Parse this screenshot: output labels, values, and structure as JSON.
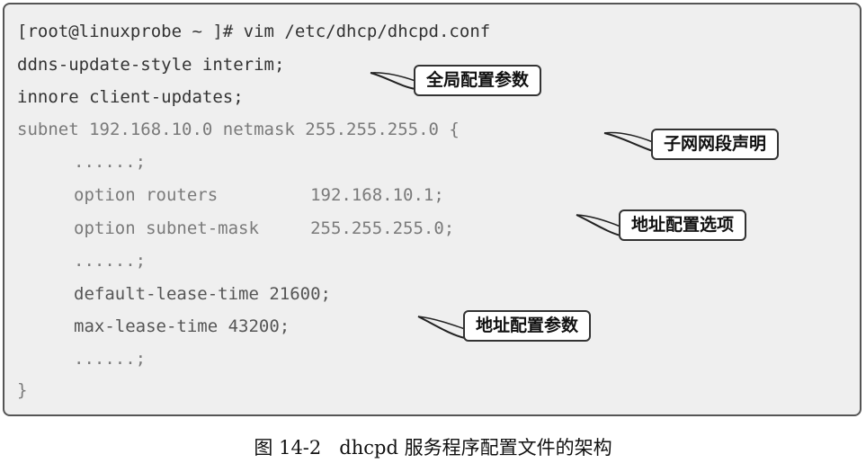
{
  "config_listing": {
    "prompt": "[root@linuxprobe ~ ]# vim /etc/dhcp/dhcpd.conf",
    "line_1": "ddns-update-style interim;",
    "line_2": "innore client-updates;",
    "line_3": "subnet 192.168.10.0 netmask 255.255.255.0 {",
    "line_4": "......;",
    "line_5": "option routers         192.168.10.1;",
    "line_6": "option subnet-mask     255.255.255.0;",
    "line_7": "......;",
    "line_8": "default-lease-time 21600;",
    "line_9": "max-lease-time 43200;",
    "line_10": "......;",
    "line_11": "}"
  },
  "callouts": {
    "global_config": "全局配置参数",
    "subnet_declaration": "子网网段声明",
    "address_options": "地址配置选项",
    "address_params": "地址配置参数"
  },
  "caption": "图 14-2   dhcpd 服务程序配置文件的架构"
}
